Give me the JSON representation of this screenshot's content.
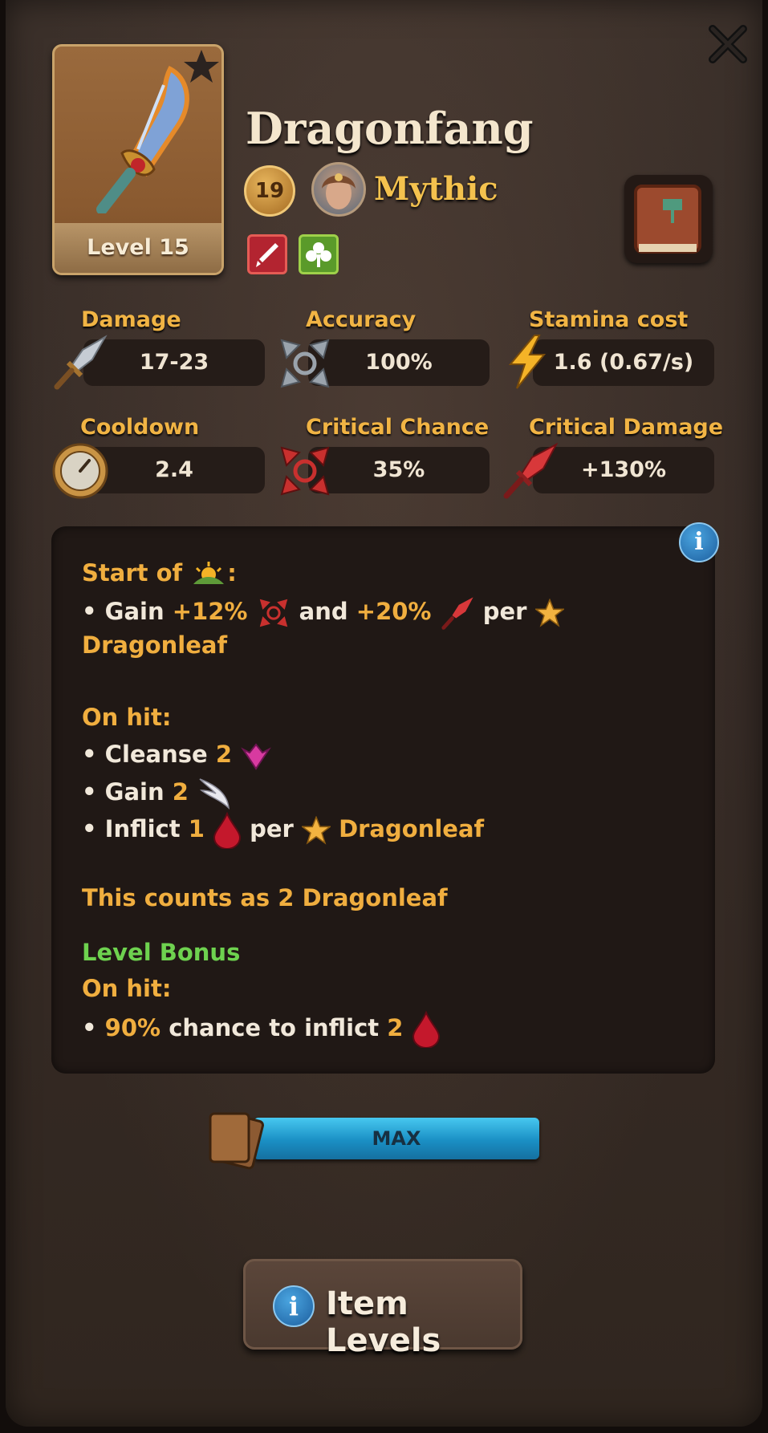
{
  "item": {
    "name": "Dragonfang",
    "level_label": "Level 15",
    "tier": "19",
    "rarity": "Mythic",
    "tags": [
      "sword-icon",
      "clover-icon"
    ]
  },
  "stats": {
    "damage": {
      "label": "Damage",
      "value": "17-23",
      "icon": "dagger-icon"
    },
    "accuracy": {
      "label": "Accuracy",
      "value": "100%",
      "icon": "crosshair-icon"
    },
    "stamina": {
      "label": "Stamina cost",
      "value": "1.6 (0.67/s)",
      "icon": "lightning-icon"
    },
    "cooldown": {
      "label": "Cooldown",
      "value": "2.4",
      "icon": "stopwatch-icon"
    },
    "crit_chance": {
      "label": "Critical Chance",
      "value": "35%",
      "icon": "crit-crosshair-icon"
    },
    "crit_damage": {
      "label": "Critical Damage",
      "value": "+130%",
      "icon": "crit-dagger-icon"
    }
  },
  "description": {
    "start_of": "Start of",
    "colon": ":",
    "bullet": "•",
    "gain": "Gain",
    "gain_crit": "+12%",
    "and": "and",
    "gain_critdmg": "+20%",
    "per": "per",
    "dragonleaf": "Dragonleaf",
    "on_hit": "On hit:",
    "cleanse": "Cleanse",
    "cleanse_n": "2",
    "gain2_n": "2",
    "inflict": "Inflict",
    "inflict_n": "1",
    "this_counts_as": "This counts as",
    "counts_n": "2",
    "level_bonus": "Level Bonus",
    "on_hit_2": "On hit:",
    "chance_pct": "90%",
    "chance_text": "chance to inflict",
    "chance_n": "2"
  },
  "progress": {
    "label": "MAX",
    "fraction": 1.0
  },
  "buttons": {
    "item_levels": "Item Levels",
    "info_glyph": "i"
  }
}
